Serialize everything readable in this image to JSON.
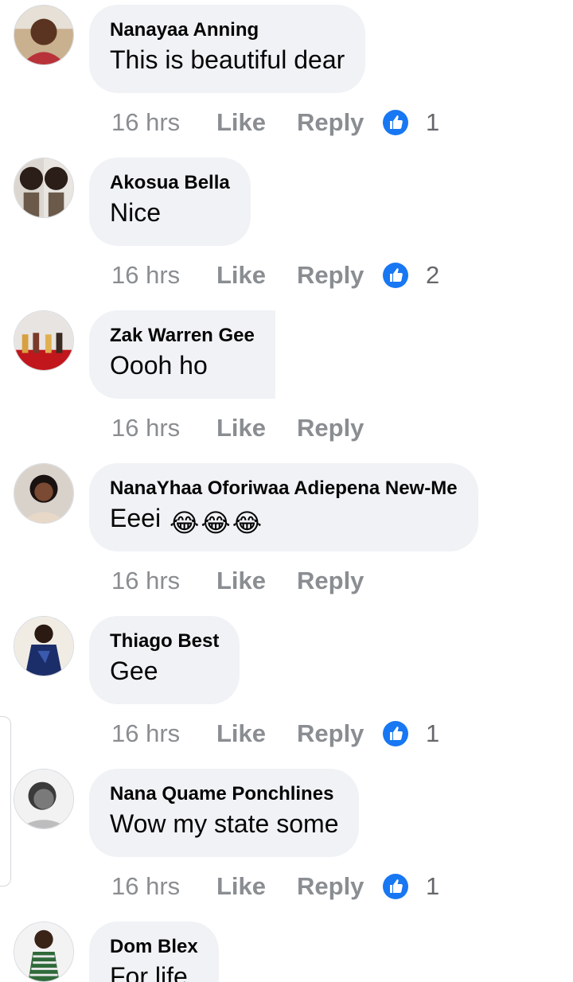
{
  "comments": [
    {
      "author": "Nanayaa Anning",
      "text": "This is beautiful dear",
      "time": "16 hrs",
      "like": "Like",
      "reply": "Reply",
      "reactions": "1",
      "avatar_icon": "profile-photo"
    },
    {
      "author": "Akosua Bella",
      "text": "Nice",
      "time": "16 hrs",
      "like": "Like",
      "reply": "Reply",
      "reactions": "2",
      "avatar_icon": "profile-photo"
    },
    {
      "author": "Zak Warren Gee",
      "text": "Oooh ho",
      "time": "16 hrs",
      "like": "Like",
      "reply": "Reply",
      "avatar_icon": "profile-photo"
    },
    {
      "author": "NanaYhaa Oforiwaa Adiepena New-Me",
      "text": "Eeei",
      "emojis": [
        "😂",
        "😂",
        "😂"
      ],
      "time": "16 hrs",
      "like": "Like",
      "reply": "Reply",
      "avatar_icon": "profile-photo"
    },
    {
      "author": "Thiago Best",
      "text": "Gee",
      "time": "16 hrs",
      "like": "Like",
      "reply": "Reply",
      "reactions": "1",
      "avatar_icon": "profile-photo"
    },
    {
      "author": "Nana Quame Ponchlines",
      "text": "Wow my state some",
      "time": "16 hrs",
      "like": "Like",
      "reply": "Reply",
      "reactions": "1",
      "avatar_icon": "profile-photo"
    },
    {
      "author": "Dom Blex",
      "text": "For life",
      "avatar_icon": "profile-photo"
    }
  ],
  "reaction_icon": "thumbs-up-icon",
  "colors": {
    "bubble": "#f0f2f5",
    "meta_text": "#8a8d91",
    "like_blue": "#1877f2",
    "text": "#050505"
  }
}
